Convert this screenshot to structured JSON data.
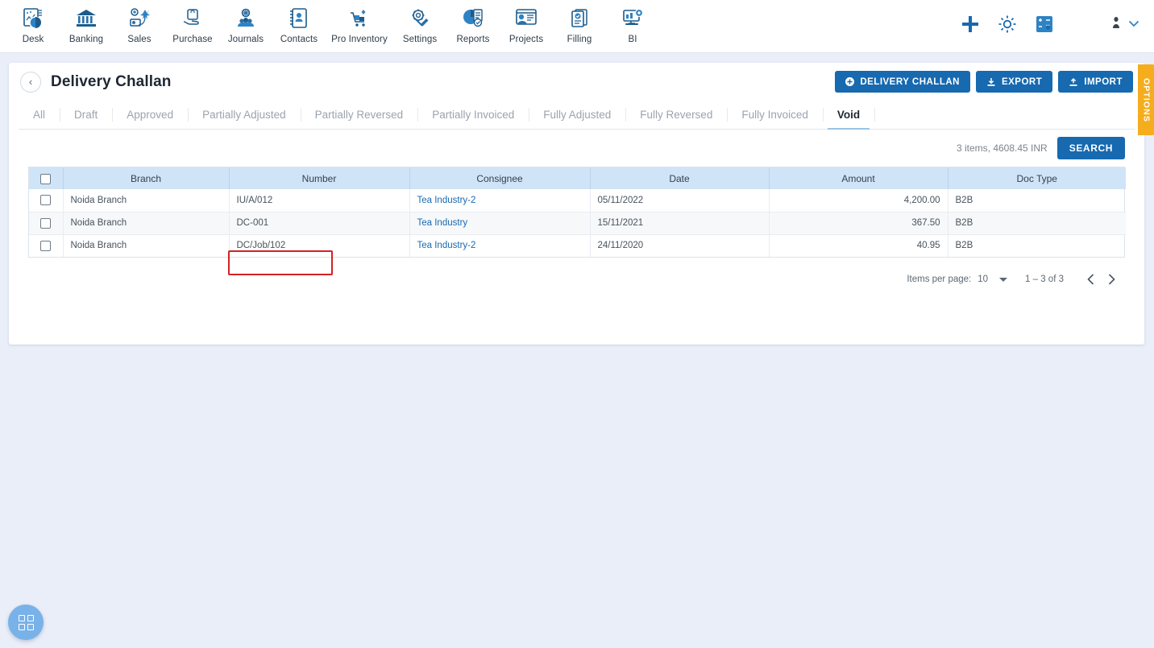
{
  "topnav": {
    "items": [
      {
        "label": "Desk",
        "icon": "desk-icon"
      },
      {
        "label": "Banking",
        "icon": "bank-icon"
      },
      {
        "label": "Sales",
        "icon": "sales-icon"
      },
      {
        "label": "Purchase",
        "icon": "purchase-icon"
      },
      {
        "label": "Journals",
        "icon": "journals-icon"
      },
      {
        "label": "Contacts",
        "icon": "contacts-icon"
      },
      {
        "label": "Pro Inventory",
        "icon": "inventory-icon"
      },
      {
        "label": "Settings",
        "icon": "settings-icon"
      },
      {
        "label": "Reports",
        "icon": "reports-icon"
      },
      {
        "label": "Projects",
        "icon": "projects-icon"
      },
      {
        "label": "Filling",
        "icon": "filling-icon"
      },
      {
        "label": "BI",
        "icon": "bi-icon"
      }
    ],
    "actions": [
      {
        "name": "add-icon",
        "glyph": "+"
      },
      {
        "name": "gear-icon",
        "glyph": "⚙"
      },
      {
        "name": "calculator-icon",
        "glyph": "⊞"
      }
    ],
    "user": {
      "avatar": "user-icon",
      "caret": "chevron-down-icon"
    }
  },
  "header": {
    "back": "‹",
    "title": "Delivery Challan",
    "buttons": [
      {
        "name": "delivery-challan-button",
        "label": "DELIVERY CHALLAN",
        "icon": "plus-circle-icon"
      },
      {
        "name": "export-button",
        "label": "EXPORT",
        "icon": "download-icon"
      },
      {
        "name": "import-button",
        "label": "IMPORT",
        "icon": "upload-icon"
      }
    ],
    "options_tab": "OPTIONS"
  },
  "tabs": [
    {
      "label": "All",
      "active": false
    },
    {
      "label": "Draft",
      "active": false
    },
    {
      "label": "Approved",
      "active": false
    },
    {
      "label": "Partially Adjusted",
      "active": false
    },
    {
      "label": "Partially Reversed",
      "active": false
    },
    {
      "label": "Partially Invoiced",
      "active": false
    },
    {
      "label": "Fully Adjusted",
      "active": false
    },
    {
      "label": "Fully Reversed",
      "active": false
    },
    {
      "label": "Fully Invoiced",
      "active": false
    },
    {
      "label": "Void",
      "active": true
    }
  ],
  "search": {
    "summary": "3 items, 4608.45 INR",
    "button_label": "SEARCH"
  },
  "table": {
    "columns": [
      "Branch",
      "Number",
      "Consignee",
      "Date",
      "Amount",
      "Doc Type"
    ],
    "rows": [
      {
        "branch": "Noida Branch",
        "number": "IU/A/012",
        "consignee": "Tea Industry-2",
        "date": "05/11/2022",
        "amount": "4,200.00",
        "doc_type": "B2B"
      },
      {
        "branch": "Noida Branch",
        "number": "DC-001",
        "consignee": "Tea Industry",
        "date": "15/11/2021",
        "amount": "367.50",
        "doc_type": "B2B"
      },
      {
        "branch": "Noida Branch",
        "number": "DC/Job/102",
        "consignee": "Tea Industry-2",
        "date": "24/11/2020",
        "amount": "40.95",
        "doc_type": "B2B"
      }
    ],
    "highlight_color": "#d32222"
  },
  "paginator": {
    "items_per_page_label": "Items per page:",
    "items_per_page_value": "10",
    "range": "1 – 3 of 3",
    "prev": "‹",
    "next": "›"
  },
  "fab": {
    "name": "apps-grid-icon"
  },
  "colors": {
    "accent": "#1769b0",
    "header_bg": "#cfe4f7",
    "page_bg": "#e9eef8",
    "options": "#f5ad1d"
  }
}
